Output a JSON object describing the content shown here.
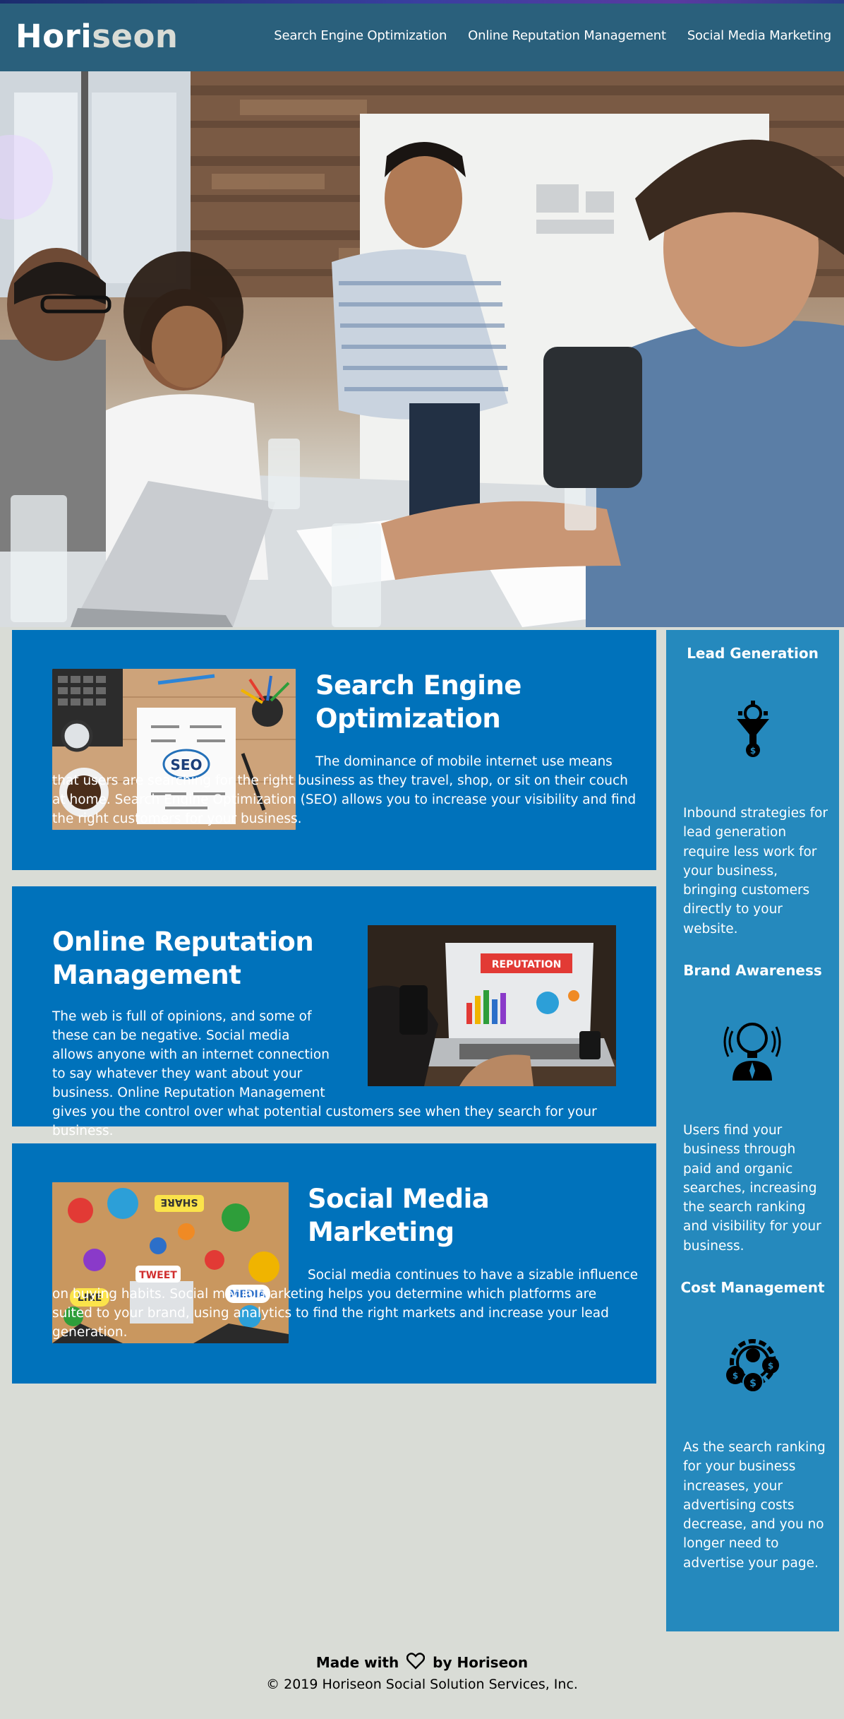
{
  "header": {
    "logo_part1": "Hori",
    "logo_part2": "seon",
    "nav": [
      "Search Engine Optimization",
      "Online Reputation Management",
      "Social Media Marketing"
    ]
  },
  "cards": [
    {
      "title": "Search Engine Optimization",
      "body": "The dominance of mobile internet use means that users are searching for the right business as they travel, shop, or sit on their couch at home. Search Engine Optimization (SEO) allows you to increase your visibility and find the right customers for your business.",
      "image_text": "SEO"
    },
    {
      "title": "Online Reputation Management",
      "body": "The web is full of opinions, and some of these can be negative. Social media allows anyone with an internet connection to say whatever they want about your business. Online Reputation Management gives you the control over what potential customers see when they search for your business.",
      "image_text": "REPUTATION"
    },
    {
      "title": "Social Media Marketing",
      "body": "Social media continues to have a sizable influence on buying habits. Social media marketing helps you determine which platforms are suited to your brand, using analytics to find the right markets and increase your lead generation.",
      "image_text_1": "SHARE",
      "image_text_2": "TWEET",
      "image_text_3": "LIKE",
      "image_text_4": "MEDIA"
    }
  ],
  "benefits": [
    {
      "title": "Lead Generation",
      "body": "Inbound strategies for lead generation require less work for your business, bringing customers directly to your website.",
      "icon": "funnel-icon"
    },
    {
      "title": "Brand Awareness",
      "body": "Users find your business through paid and organic searches, increasing the search ranking and visibility for your business.",
      "icon": "lightbulb-person-icon"
    },
    {
      "title": "Cost Management",
      "body": "As the search ranking for your business increases, your advertising costs decrease, and you no longer need to advertise your page.",
      "icon": "gear-money-icon"
    }
  ],
  "footer": {
    "made_with": "Made with",
    "by": "by Horiseon",
    "copyright": "© 2019 Horiseon Social Solution Services, Inc."
  },
  "colors": {
    "header_bg": "#2a607c",
    "card_bg": "#0072bb",
    "sidebar_bg": "#2589bd",
    "page_bg": "#d9dcd6"
  }
}
